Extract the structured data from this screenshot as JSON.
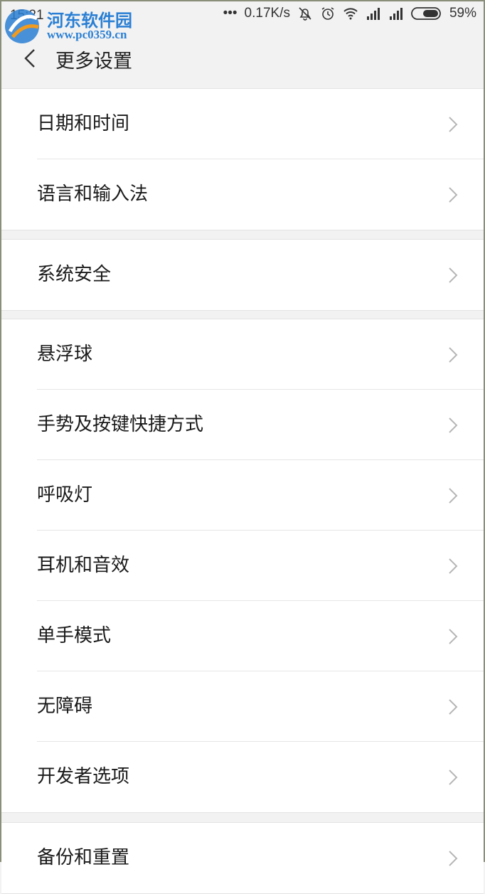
{
  "status": {
    "time": "15:21",
    "more": "•••",
    "net_speed": "0.17K/s",
    "battery": "59%",
    "icons": [
      "mute-icon",
      "alarm-icon",
      "wifi-icon",
      "signal-icon",
      "signal-icon",
      "battery-icon"
    ]
  },
  "watermark": {
    "name": "河东软件园",
    "url": "www.pc0359.cn"
  },
  "header": {
    "title": "更多设置",
    "back_icon": "back-chevron-icon"
  },
  "groups": [
    {
      "items": [
        "日期和时间",
        "语言和输入法"
      ]
    },
    {
      "items": [
        "系统安全"
      ]
    },
    {
      "items": [
        "悬浮球",
        "手势及按键快捷方式",
        "呼吸灯",
        "耳机和音效",
        "单手模式",
        "无障碍",
        "开发者选项"
      ]
    },
    {
      "items": [
        "备份和重置"
      ]
    }
  ],
  "colors": {
    "page_bg": "#f2f2f2",
    "card_bg": "#ffffff",
    "text": "#1a1a1a",
    "chevron": "#b5b5b5",
    "watermark": "#2a7fd4"
  }
}
